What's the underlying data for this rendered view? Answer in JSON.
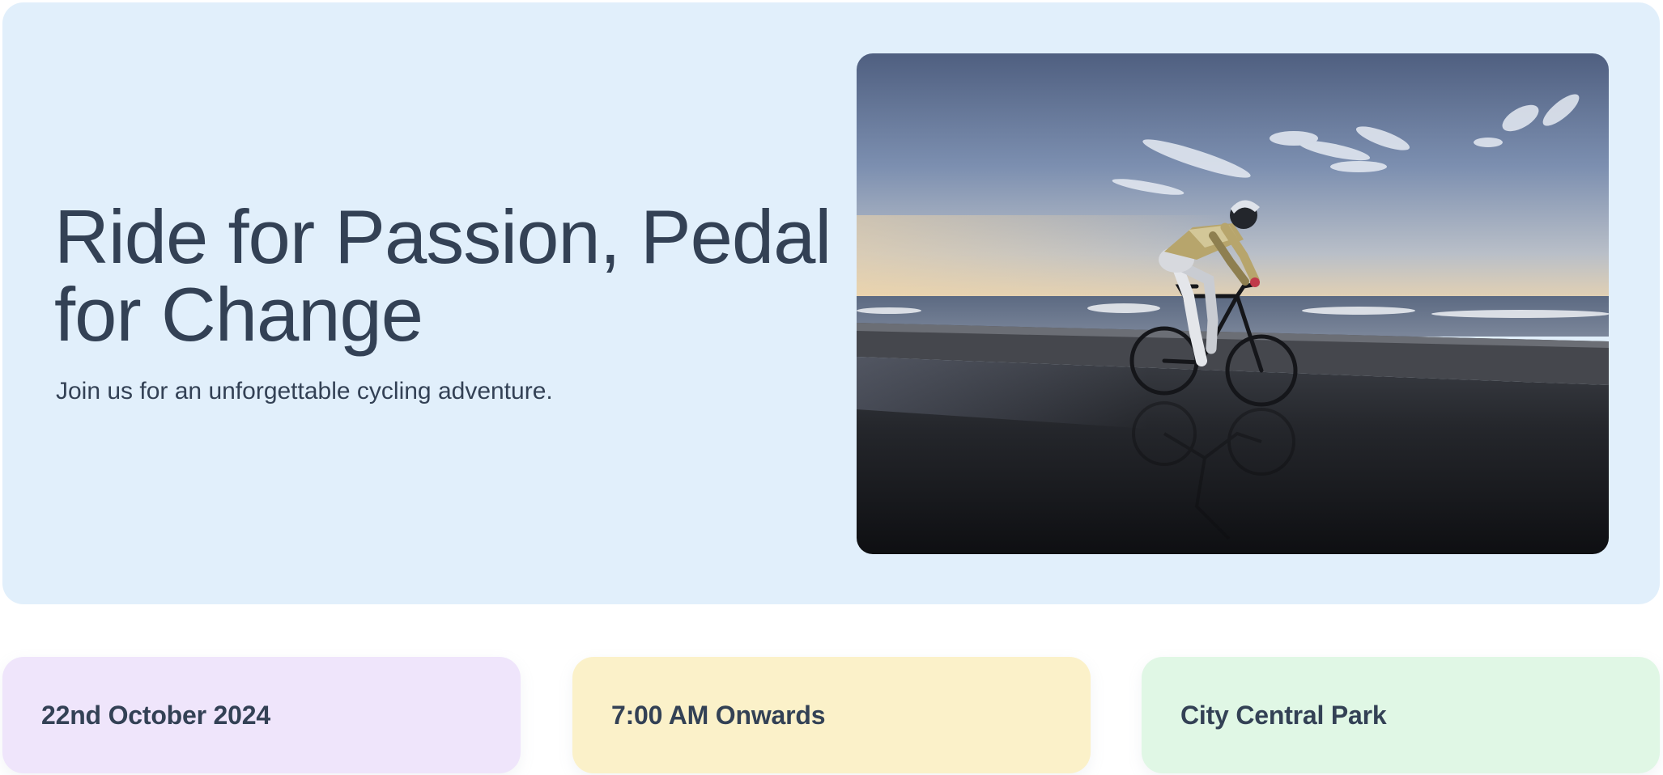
{
  "hero": {
    "title": "Ride for Passion, Pedal for Change",
    "subtitle": "Join us for an unforgettable cycling adventure.",
    "image_subject": "cyclist riding along a wet seaside promenade at sunrise"
  },
  "details": {
    "date": "22nd October 2024",
    "time": "7:00 AM Onwards",
    "location": "City Central Park"
  },
  "colors": {
    "hero_background": "#e1effb",
    "text": "#334155",
    "date_card": "#efe5fb",
    "time_card": "#fbf1c9",
    "location_card": "#e0f7e5"
  }
}
